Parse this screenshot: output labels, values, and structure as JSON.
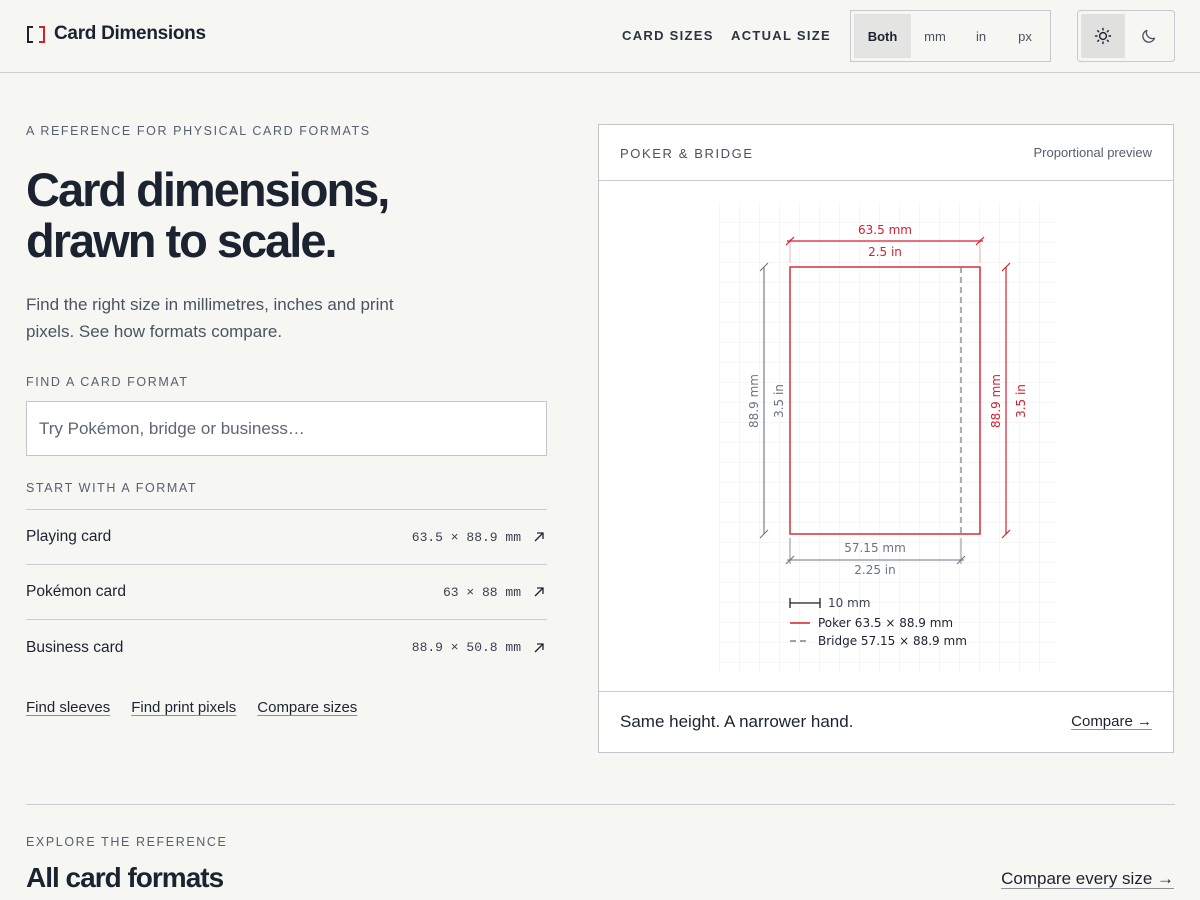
{
  "header": {
    "brand": "Card Dimensions",
    "nav": {
      "card_sizes": "CARD SIZES",
      "actual_size": "ACTUAL SIZE"
    },
    "units": [
      "Both",
      "mm",
      "in",
      "px"
    ],
    "active_unit": "Both",
    "theme_icons": [
      "sun-icon",
      "moon-icon"
    ],
    "active_theme": "light"
  },
  "hero": {
    "eyebrow": "A REFERENCE FOR PHYSICAL CARD FORMATS",
    "title_line1": "Card dimensions,",
    "title_line2": "drawn to scale.",
    "subtitle": "Find the right size in millimetres, inches and print pixels. See how formats compare."
  },
  "search": {
    "label": "FIND A CARD FORMAT",
    "placeholder": "Try Pokémon, bridge or business…",
    "value": ""
  },
  "formats": {
    "label": "START WITH A FORMAT",
    "items": [
      {
        "name": "Playing card",
        "dims": "63.5 × 88.9 mm"
      },
      {
        "name": "Pokémon card",
        "dims": "63 × 88 mm"
      },
      {
        "name": "Business card",
        "dims": "88.9 × 50.8 mm"
      }
    ]
  },
  "quick_links": {
    "sleeves": "Find sleeves",
    "print_pixels": "Find print pixels",
    "compare": "Compare sizes"
  },
  "preview": {
    "title": "POKER & BRIDGE",
    "note": "Proportional preview",
    "top_mm": "63.5 mm",
    "top_in": "2.5 in",
    "left_mm": "88.9 mm",
    "left_in": "3.5 in",
    "right_mm": "88.9 mm",
    "right_in": "3.5 in",
    "bottom_mm": "57.15 mm",
    "bottom_in": "2.25 in",
    "scale_label": "10 mm",
    "legend_poker": "Poker 63.5 × 88.9 mm",
    "legend_bridge": "Bridge 57.15 × 88.9 mm",
    "caption": "Same height. A narrower hand.",
    "compare_link": "Compare →",
    "accent": "#d4202e",
    "muted": "#6b7480"
  },
  "explore": {
    "eyebrow": "EXPLORE THE REFERENCE",
    "title": "All card formats",
    "compare_all": "Compare every size →"
  }
}
